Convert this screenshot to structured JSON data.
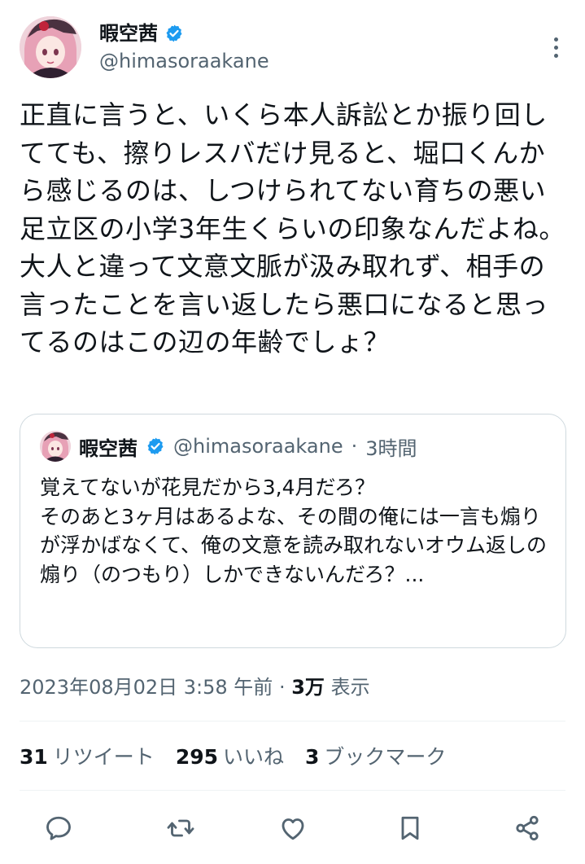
{
  "author": {
    "display_name": "暇空茜",
    "handle": "@himasoraakane",
    "verified_color": "#1d9bf0"
  },
  "tweet": {
    "text": "正直に言うと、いくら本人訴訟とか振り回してても、擦りレスバだけ見ると、堀口くんから感じるのは、しつけられてない育ちの悪い足立区の小学3年生くらいの印象なんだよね。\n大人と違って文意文脈が汲み取れず、相手の言ったことを言い返したら悪口になると思ってるのはこの辺の年齢でしょ？"
  },
  "quote": {
    "display_name": "暇空茜",
    "handle": "@himasoraakane",
    "separator": "·",
    "time": "3時間",
    "text": "覚えてないが花見だから3,4月だろ？\nそのあと3ヶ月はあるよな、その間の俺には一言も煽りが浮かばなくて、俺の文意を読み取れないオウム返しの煽り（のつもり）しかできないんだろ？..."
  },
  "meta": {
    "datetime": "2023年08月02日 3:58 午前",
    "separator": "·",
    "views_count": "3万",
    "views_label": "表示"
  },
  "stats": {
    "retweets_count": "31",
    "retweets_label": "リツイート",
    "likes_count": "295",
    "likes_label": "いいね",
    "bookmarks_count": "3",
    "bookmarks_label": "ブックマーク"
  },
  "icons": {
    "more": "more-vertical-icon",
    "reply": "reply-icon",
    "retweet": "retweet-icon",
    "like": "heart-icon",
    "bookmark": "bookmark-icon",
    "share": "share-icon"
  },
  "colors": {
    "text": "#0f1419",
    "secondary": "#536471",
    "border": "#cfd9de"
  }
}
